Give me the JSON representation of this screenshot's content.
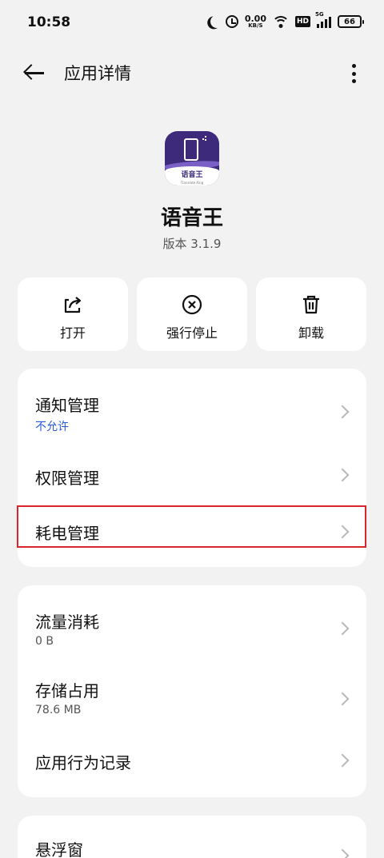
{
  "status_bar": {
    "time": "10:58",
    "net_speed_value": "0.00",
    "net_speed_unit": "KB/S",
    "hd": "HD",
    "network": "5G",
    "battery": "66"
  },
  "header": {
    "title": "应用详情"
  },
  "app": {
    "name": "语音王",
    "version": "版本 3.1.9",
    "icon_text": "语音王",
    "icon_subtext": "Translate King"
  },
  "actions": {
    "open_label": "打开",
    "force_stop_label": "强行停止",
    "uninstall_label": "卸载"
  },
  "card1": {
    "notification_title": "通知管理",
    "notification_sub": "不允许",
    "permission_title": "权限管理",
    "battery_title": "耗电管理"
  },
  "card2": {
    "data_usage_title": "流量消耗",
    "data_usage_sub": "0 B",
    "storage_title": "存储占用",
    "storage_sub": "78.6 MB",
    "behavior_title": "应用行为记录"
  },
  "card3": {
    "floating_window_title": "悬浮窗"
  },
  "colors": {
    "highlight": "#d9262c",
    "link_blue": "#2a5bd7",
    "icon_purple": "#3d2a7a"
  }
}
